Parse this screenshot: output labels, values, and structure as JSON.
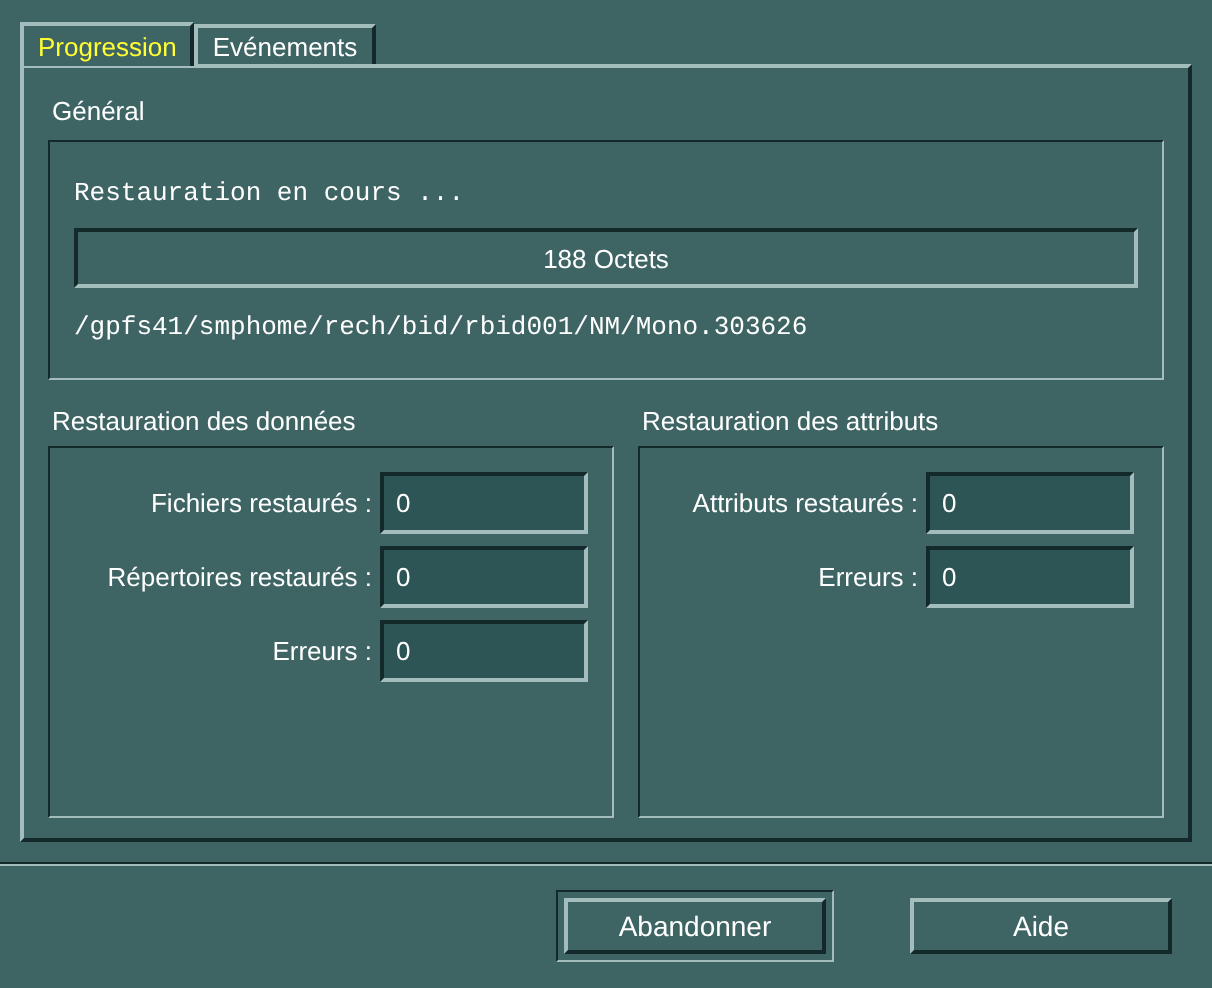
{
  "tabs": [
    {
      "label": "Progression",
      "selected": true
    },
    {
      "label": "Evénements",
      "selected": false
    }
  ],
  "general": {
    "title": "Général",
    "status": "Restauration en cours ...",
    "progress_text": "188 Octets",
    "level": 0,
    "path": "/gpfs41/smphome/rech/bid/rbid001/NM/Mono.303626"
  },
  "groups": [
    {
      "title": "Restauration des données",
      "fields": [
        {
          "label": "Fichiers restaurés :",
          "value": "0"
        },
        {
          "label": "Répertoires restaurés :",
          "value": "0"
        },
        {
          "label": "Erreurs :",
          "value": "0"
        }
      ]
    },
    {
      "title": "Restauration des attributs",
      "fields": [
        {
          "label": "Attributs restaurés :",
          "value": "0"
        },
        {
          "label": "Erreurs :",
          "value": "0"
        }
      ]
    }
  ],
  "buttons": [
    {
      "label": "Abandonner",
      "default": true
    },
    {
      "label": "Aide",
      "default": false
    }
  ]
}
